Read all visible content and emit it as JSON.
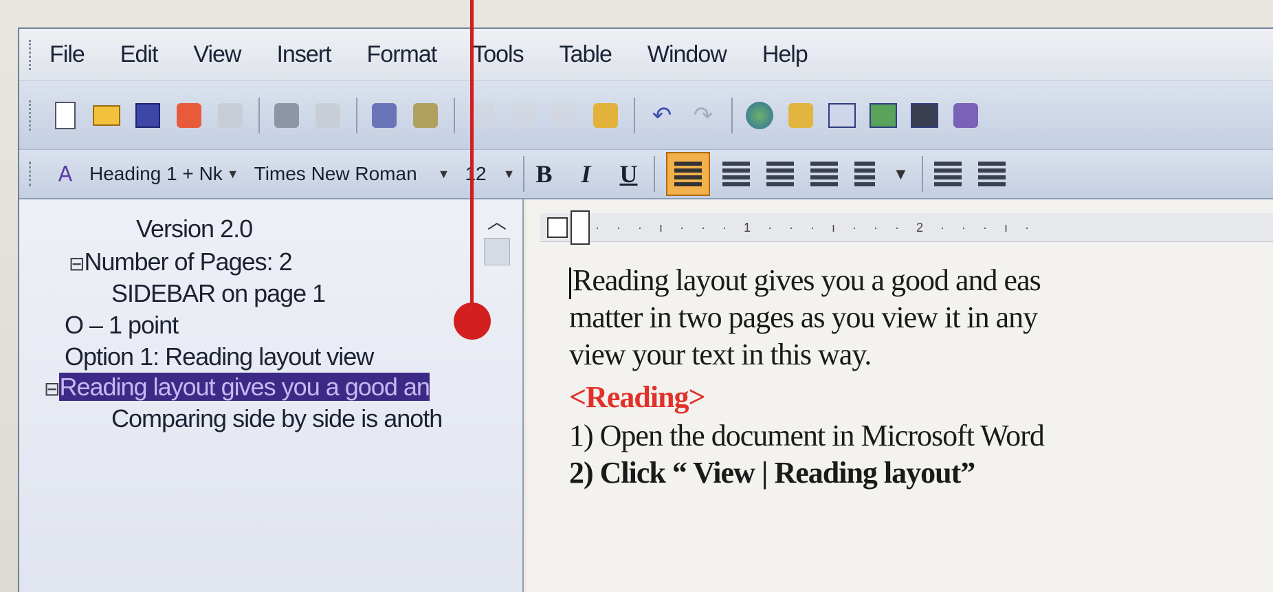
{
  "menubar": {
    "items": [
      "File",
      "Edit",
      "View",
      "Insert",
      "Format",
      "Tools",
      "Table",
      "Window",
      "Help"
    ]
  },
  "standard_toolbar": {
    "icons": [
      "new-document-icon",
      "open-folder-icon",
      "save-icon",
      "permission-icon",
      "email-icon",
      "print-icon",
      "print-preview-icon",
      "spelling-icon",
      "research-icon",
      "cut-icon",
      "copy-icon",
      "paste-icon",
      "format-painter-icon",
      "undo-icon",
      "redo-icon",
      "hyperlink-icon",
      "tables-borders-icon",
      "insert-table-icon",
      "insert-excel-icon",
      "columns-icon",
      "drawing-icon"
    ]
  },
  "formatting_toolbar": {
    "style": "Heading 1 + Nk",
    "font": "Times New Roman",
    "size": "12",
    "bold": "B",
    "italic": "I",
    "underline": "U",
    "active_alignment": "align-left"
  },
  "navigation_pane": {
    "items": [
      {
        "text": "Version 2.0",
        "expander": ""
      },
      {
        "text": "Number of Pages: 2",
        "expander": "⊟"
      },
      {
        "text": "SIDEBAR on page 1",
        "expander": ""
      },
      {
        "text": "O – 1 point",
        "expander": ""
      },
      {
        "text": "Option 1: Reading layout view",
        "expander": ""
      },
      {
        "text": "Reading layout gives you a good an",
        "expander": "⊟"
      },
      {
        "text": "Comparing side by side is anoth",
        "expander": ""
      }
    ]
  },
  "ruler": {
    "labels": "· · · ı · · · 1 · · · ı · · · 2 · · · ı ·"
  },
  "document": {
    "lines": [
      "Reading layout gives you a good and eas",
      "matter in two pages as you view it in any",
      "view your text in this way."
    ],
    "tag": "<Reading>",
    "steps": [
      "1) Open the document in Microsoft Word",
      "2) Click “ View | Reading layout”"
    ]
  },
  "colors": {
    "callout": "#d01d1d",
    "highlight_bg": "#3b2a86",
    "active_button": "#f2b14a"
  }
}
